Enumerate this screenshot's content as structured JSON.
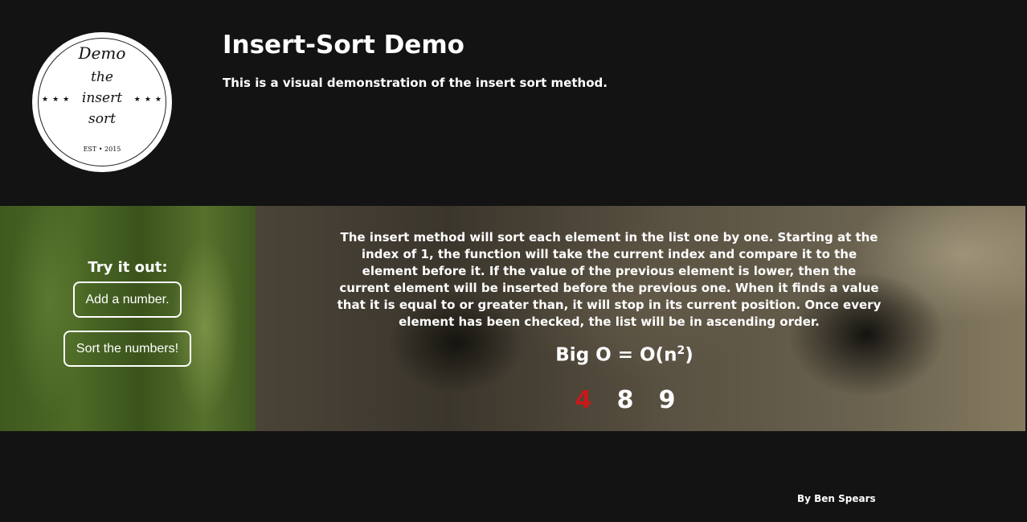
{
  "header": {
    "logo": {
      "line1": "Demo",
      "line2": "the",
      "line3": "insert",
      "line4": "sort",
      "stars": "★★★",
      "est": "EST • 2015"
    },
    "title": "Insert-Sort Demo",
    "subtitle": "This is a visual demonstration of the insert sort method."
  },
  "controls": {
    "try_label": "Try it out:",
    "add_button": "Add a number.",
    "sort_button": "Sort the numbers!"
  },
  "explanation": {
    "description": "The insert method will sort each element in the list one by one. Starting at the index of 1, the function will take the current index and compare it to the element before it. If the value of the previous element is lower, then the current element will be inserted before the previous one. When it finds a value that it is equal to or greater than, it will stop in its current position. Once every element has been checked, the list will be in ascending order.",
    "bigo_prefix": "Big O = O(n",
    "bigo_exp": "2",
    "bigo_suffix": ")"
  },
  "numbers": {
    "items": [
      "4",
      "8",
      "9"
    ],
    "active_color": "#c41a1a"
  },
  "footer": {
    "credit": "By Ben Spears"
  }
}
